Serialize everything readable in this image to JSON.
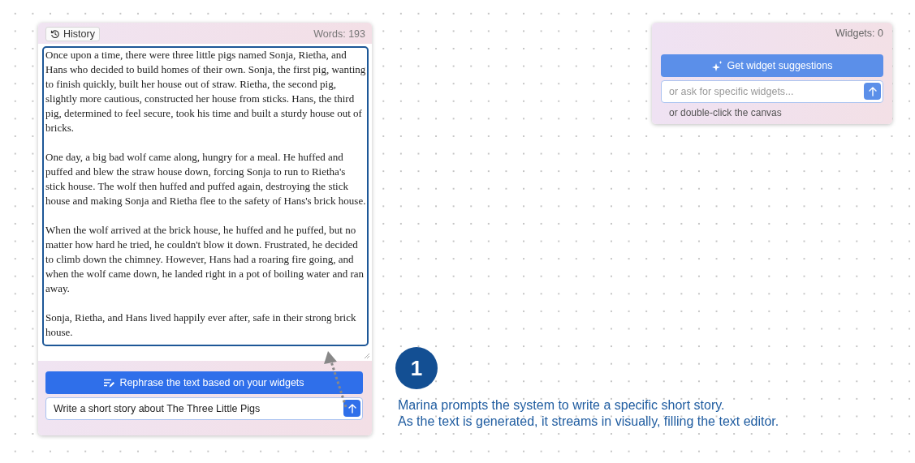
{
  "editor_panel": {
    "history_button": "History",
    "word_count": "Words: 193",
    "story": [
      "Once upon a time, there were three little pigs named Sonja, Rietha, and Hans who decided to build homes of their own. Sonja, the first pig, wanting to finish quickly, built her house out of straw. Rietha, the second pig, slightly more cautious, constructed her house from sticks. Hans, the third pig, determined to feel secure, took his time and built a sturdy house out of bricks.",
      "One day, a big bad wolf came along, hungry for a meal. He huffed and puffed and blew the straw house down, forcing Sonja to run to Rietha's stick house. The wolf then huffed and puffed again, destroying the stick house and making Sonja and Rietha flee to the safety of Hans's brick house.",
      "When the wolf arrived at the brick house, he huffed and he puffed, but no matter how hard he tried, he couldn't blow it down. Frustrated, he decided to climb down the chimney. However, Hans had a roaring fire going, and when the wolf came down, he landed right in a pot of boiling water and ran away.",
      "Sonja, Rietha, and Hans lived happily ever after, safe in their strong brick house."
    ],
    "rephrase_button": "Rephrase the text based on your widgets",
    "prompt": {
      "value": "Write a short story about The Three Little Pigs"
    }
  },
  "widget_panel": {
    "widget_count": "Widgets: 0",
    "suggest_button": "Get widget suggestions",
    "ask": {
      "placeholder": "or ask for specific widgets..."
    },
    "hint": "or double-click the canvas"
  },
  "annotation": {
    "step": "1",
    "caption": [
      "Marina prompts the system to write a specific short story.",
      "As the text is generated, it streams in visually, filling the text editor."
    ]
  }
}
